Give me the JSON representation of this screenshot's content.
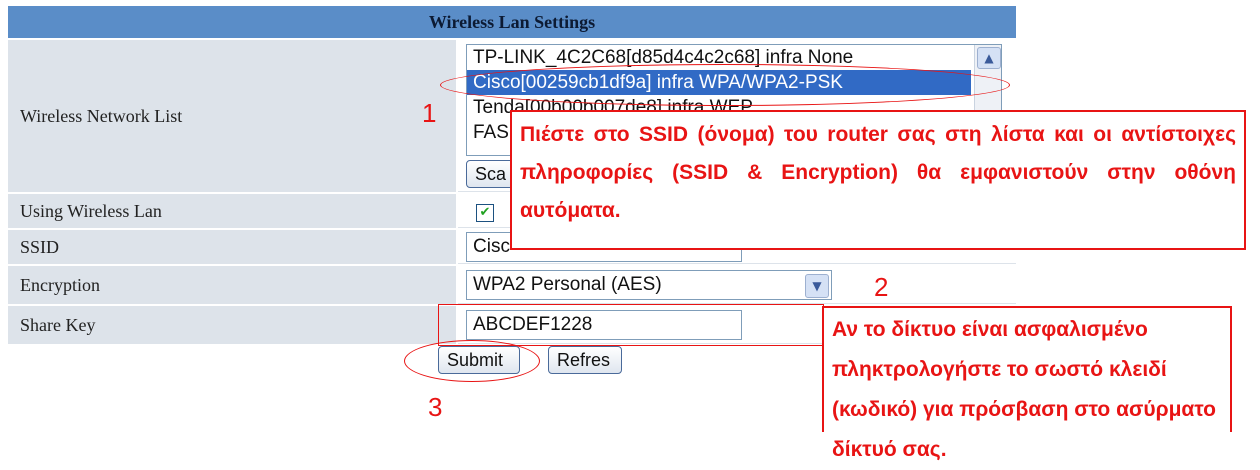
{
  "title": "Wireless Lan Settings",
  "labels": {
    "network_list": "Wireless Network List",
    "using_wlan": "Using Wireless Lan",
    "ssid": "SSID",
    "encryption": "Encryption",
    "share_key": "Share Key"
  },
  "network_list": {
    "items": [
      "TP-LINK_4C2C68[d85d4c4c2c68] infra None",
      "Cisco[00259cb1df9a] infra WPA/WPA2-PSK",
      "Tenda[00b00b007de8] infra WEP",
      "FAS"
    ]
  },
  "scan_button": "Sca",
  "using_wlan_checked": true,
  "ssid_value": "Cisc",
  "encryption_value": "WPA2 Personal (AES)",
  "share_key_value": "ABCDEF1228",
  "submit_label": "Submit",
  "refresh_label": "Refres",
  "annotations": {
    "step1": "1",
    "step2": "2",
    "step3": "3",
    "callout1": "Πιέστε στο SSID (όνομα) του router σας στη λίστα και οι αντίστοιχες πληροφορίες (SSID & Encryption) θα εμφανιστούν στην οθόνη αυτόματα.",
    "callout2": "Αν το δίκτυο είναι ασφαλισμένο πληκτρολογήστε το σωστό κλειδί (κωδικό) για πρόσβαση στο ασύρματο δίκτυό σας."
  },
  "colors": {
    "title_bg": "#5a8dc8",
    "label_bg": "#dde3ea",
    "selection": "#316ac5",
    "annotation_red": "#e81414"
  }
}
